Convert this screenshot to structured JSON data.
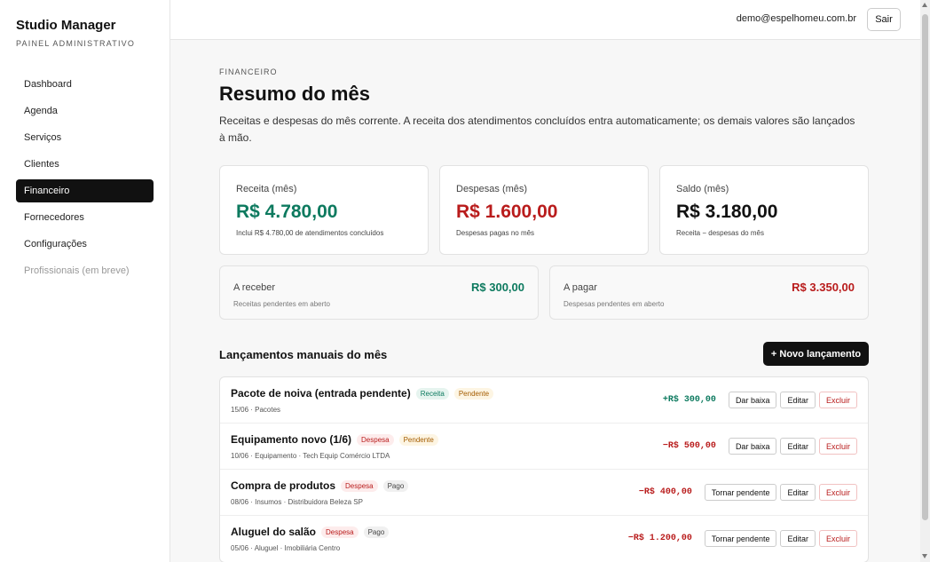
{
  "brand": {
    "title": "Studio Manager",
    "subtitle": "PAINEL ADMINISTRATIVO"
  },
  "nav": [
    {
      "label": "Dashboard"
    },
    {
      "label": "Agenda"
    },
    {
      "label": "Serviços"
    },
    {
      "label": "Clientes"
    },
    {
      "label": "Financeiro",
      "active": true
    },
    {
      "label": "Fornecedores"
    },
    {
      "label": "Configurações"
    },
    {
      "label": "Profissionais (em breve)",
      "disabled": true
    }
  ],
  "topbar": {
    "user_email": "demo@espelhomeu.com.br",
    "logout_label": "Sair"
  },
  "header": {
    "eyebrow": "FINANCEIRO",
    "title": "Resumo do mês",
    "description": "Receitas e despesas do mês corrente. A receita dos atendimentos concluídos entra automaticamente; os demais valores são lançados à mão."
  },
  "summary": {
    "revenue": {
      "label": "Receita (mês)",
      "value": "R$ 4.780,00",
      "note": "Inclui R$ 4.780,00 de atendimentos concluídos"
    },
    "expenses": {
      "label": "Despesas (mês)",
      "value": "R$ 1.600,00",
      "note": "Despesas pagas no mês"
    },
    "balance": {
      "label": "Saldo (mês)",
      "value": "R$ 3.180,00",
      "note": "Receita − despesas do mês"
    }
  },
  "pending": {
    "receivable": {
      "label": "A receber",
      "value": "R$ 300,00",
      "note": "Receitas pendentes em aberto"
    },
    "payable": {
      "label": "A pagar",
      "value": "R$ 3.350,00",
      "note": "Despesas pendentes em aberto"
    }
  },
  "entries": {
    "title": "Lançamentos manuais do mês",
    "new_button": "+ Novo lançamento",
    "edit_label": "Editar",
    "delete_label": "Excluir",
    "items": [
      {
        "title": "Pacote de noiva (entrada pendente)",
        "type": "Receita",
        "status": "Pendente",
        "meta": "15/06 · Pacotes",
        "amount": "+R$ 300,00",
        "action": "Dar baixa"
      },
      {
        "title": "Equipamento novo (1/6)",
        "type": "Despesa",
        "status": "Pendente",
        "meta": "10/06 · Equipamento · Tech Equip Comércio LTDA",
        "amount": "−R$ 500,00",
        "action": "Dar baixa"
      },
      {
        "title": "Compra de produtos",
        "type": "Despesa",
        "status": "Pago",
        "meta": "08/06 · Insumos · Distribuidora Beleza SP",
        "amount": "−R$ 400,00",
        "action": "Tornar pendente"
      },
      {
        "title": "Aluguel do salão",
        "type": "Despesa",
        "status": "Pago",
        "meta": "05/06 · Aluguel · Imobiliária Centro",
        "amount": "−R$ 1.200,00",
        "action": "Tornar pendente"
      }
    ]
  },
  "colors": {
    "positive": "#0d7a5f",
    "negative": "#b91c1c",
    "accent": "#111111"
  }
}
